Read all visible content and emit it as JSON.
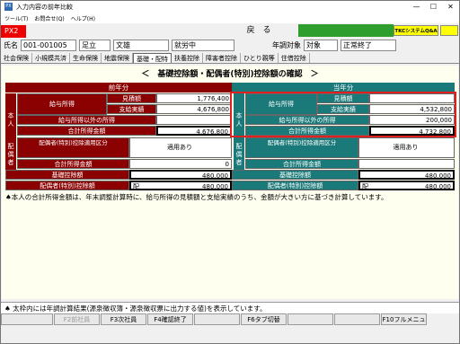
{
  "window": {
    "title": "入力内容の前年比較",
    "min": "—",
    "max": "☐",
    "close": "✕"
  },
  "menu": [
    "ツール(T)",
    "お問合せ(Q)",
    "ヘルプ(H)"
  ],
  "toolbar": {
    "px2": "PX2",
    "back": "戻　る",
    "tkc": "TKCシステムQ&A"
  },
  "info": {
    "name_label": "氏名",
    "code": "001-001005",
    "name1": "足立",
    "name2": "文雄",
    "status": "就労中",
    "year_label": "年調対象",
    "target": "対象",
    "state": "正常終了"
  },
  "tabs": [
    "社会保険",
    "小規模共済",
    "生命保険",
    "地震保険",
    "基礎・配特",
    "扶養控除",
    "障害者控除",
    "ひとり親等",
    "住借控除"
  ],
  "heading": "＜　基礎控除額・配偶者(特別)控除額の確認　＞",
  "prev": {
    "header": "前年分",
    "honnin": "本人",
    "salary": "給与所得",
    "mitsumori": "見積額",
    "mitsumori_val": "1,776,400",
    "shiharai": "支給実績",
    "shiharai_val": "4,676,800",
    "other": "給与所得以外の所得",
    "other_val": "",
    "total": "合計所得金額",
    "total_val": "4,676,800",
    "haigu": "配偶者",
    "kubun": "配偶者(特別)控除適用区分",
    "kubun_val": "適用あり",
    "h_total": "合計所得金額",
    "h_total_val": "0",
    "kiso": "基礎控除額",
    "kiso_val": "480,000",
    "haigu_ded": "配偶者(特別)控除額",
    "haigu_ded_prefix": "配",
    "haigu_ded_val": "480,000"
  },
  "curr": {
    "header": "当年分",
    "honnin": "本人",
    "salary": "給与所得",
    "mitsumori": "見積額",
    "mitsumori_val": "",
    "shiharai": "支給実績",
    "shiharai_val": "4,532,800",
    "other": "給与所得以外の所得",
    "other_val": "200,000",
    "total": "合計所得金額",
    "total_val": "4,732,800",
    "haigu": "配偶者",
    "kubun": "配偶者(特別)控除適用区分",
    "kubun_val": "適用あり",
    "h_total": "合計所得金額",
    "h_total_val": "",
    "kiso": "基礎控除額",
    "kiso_val": "480,000",
    "haigu_ded": "配偶者(特別)控除額",
    "haigu_ded_prefix": "配",
    "haigu_ded_val": "480,000"
  },
  "note": "♠本人の合計所得金額は、年末調整計算時に、給与所得の見積額と支給実績のうち、金額が大きい方に基づき計算しています。",
  "footnote": "♠ 太枠内には年調計算結果(源泉徴収簿・源泉徴収票に出力する値)を表示しています。",
  "fkeys": [
    {
      "label": "F2前社員",
      "disabled": true
    },
    {
      "label": "F3次社員",
      "disabled": false
    },
    {
      "label": "F4確認終了",
      "disabled": false
    },
    {
      "label": "",
      "disabled": true
    },
    {
      "label": "F6タブ切替",
      "disabled": false
    },
    {
      "label": "",
      "disabled": true
    },
    {
      "label": "",
      "disabled": true
    },
    {
      "label": "F10フルメニュー",
      "disabled": false
    }
  ]
}
